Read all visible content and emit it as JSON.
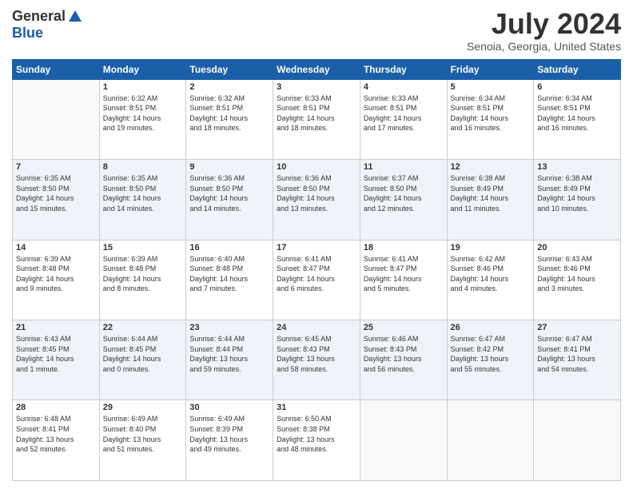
{
  "logo": {
    "general": "General",
    "blue": "Blue"
  },
  "title": "July 2024",
  "location": "Senoia, Georgia, United States",
  "days_header": [
    "Sunday",
    "Monday",
    "Tuesday",
    "Wednesday",
    "Thursday",
    "Friday",
    "Saturday"
  ],
  "weeks": [
    {
      "days": [
        {
          "num": "",
          "info": ""
        },
        {
          "num": "1",
          "info": "Sunrise: 6:32 AM\nSunset: 8:51 PM\nDaylight: 14 hours\nand 19 minutes."
        },
        {
          "num": "2",
          "info": "Sunrise: 6:32 AM\nSunset: 8:51 PM\nDaylight: 14 hours\nand 18 minutes."
        },
        {
          "num": "3",
          "info": "Sunrise: 6:33 AM\nSunset: 8:51 PM\nDaylight: 14 hours\nand 18 minutes."
        },
        {
          "num": "4",
          "info": "Sunrise: 6:33 AM\nSunset: 8:51 PM\nDaylight: 14 hours\nand 17 minutes."
        },
        {
          "num": "5",
          "info": "Sunrise: 6:34 AM\nSunset: 8:51 PM\nDaylight: 14 hours\nand 16 minutes."
        },
        {
          "num": "6",
          "info": "Sunrise: 6:34 AM\nSunset: 8:51 PM\nDaylight: 14 hours\nand 16 minutes."
        }
      ]
    },
    {
      "days": [
        {
          "num": "7",
          "info": "Sunrise: 6:35 AM\nSunset: 8:50 PM\nDaylight: 14 hours\nand 15 minutes."
        },
        {
          "num": "8",
          "info": "Sunrise: 6:35 AM\nSunset: 8:50 PM\nDaylight: 14 hours\nand 14 minutes."
        },
        {
          "num": "9",
          "info": "Sunrise: 6:36 AM\nSunset: 8:50 PM\nDaylight: 14 hours\nand 14 minutes."
        },
        {
          "num": "10",
          "info": "Sunrise: 6:36 AM\nSunset: 8:50 PM\nDaylight: 14 hours\nand 13 minutes."
        },
        {
          "num": "11",
          "info": "Sunrise: 6:37 AM\nSunset: 8:50 PM\nDaylight: 14 hours\nand 12 minutes."
        },
        {
          "num": "12",
          "info": "Sunrise: 6:38 AM\nSunset: 8:49 PM\nDaylight: 14 hours\nand 11 minutes."
        },
        {
          "num": "13",
          "info": "Sunrise: 6:38 AM\nSunset: 8:49 PM\nDaylight: 14 hours\nand 10 minutes."
        }
      ]
    },
    {
      "days": [
        {
          "num": "14",
          "info": "Sunrise: 6:39 AM\nSunset: 8:48 PM\nDaylight: 14 hours\nand 9 minutes."
        },
        {
          "num": "15",
          "info": "Sunrise: 6:39 AM\nSunset: 8:48 PM\nDaylight: 14 hours\nand 8 minutes."
        },
        {
          "num": "16",
          "info": "Sunrise: 6:40 AM\nSunset: 8:48 PM\nDaylight: 14 hours\nand 7 minutes."
        },
        {
          "num": "17",
          "info": "Sunrise: 6:41 AM\nSunset: 8:47 PM\nDaylight: 14 hours\nand 6 minutes."
        },
        {
          "num": "18",
          "info": "Sunrise: 6:41 AM\nSunset: 8:47 PM\nDaylight: 14 hours\nand 5 minutes."
        },
        {
          "num": "19",
          "info": "Sunrise: 6:42 AM\nSunset: 8:46 PM\nDaylight: 14 hours\nand 4 minutes."
        },
        {
          "num": "20",
          "info": "Sunrise: 6:43 AM\nSunset: 8:46 PM\nDaylight: 14 hours\nand 3 minutes."
        }
      ]
    },
    {
      "days": [
        {
          "num": "21",
          "info": "Sunrise: 6:43 AM\nSunset: 8:45 PM\nDaylight: 14 hours\nand 1 minute."
        },
        {
          "num": "22",
          "info": "Sunrise: 6:44 AM\nSunset: 8:45 PM\nDaylight: 14 hours\nand 0 minutes."
        },
        {
          "num": "23",
          "info": "Sunrise: 6:44 AM\nSunset: 8:44 PM\nDaylight: 13 hours\nand 59 minutes."
        },
        {
          "num": "24",
          "info": "Sunrise: 6:45 AM\nSunset: 8:43 PM\nDaylight: 13 hours\nand 58 minutes."
        },
        {
          "num": "25",
          "info": "Sunrise: 6:46 AM\nSunset: 8:43 PM\nDaylight: 13 hours\nand 56 minutes."
        },
        {
          "num": "26",
          "info": "Sunrise: 6:47 AM\nSunset: 8:42 PM\nDaylight: 13 hours\nand 55 minutes."
        },
        {
          "num": "27",
          "info": "Sunrise: 6:47 AM\nSunset: 8:41 PM\nDaylight: 13 hours\nand 54 minutes."
        }
      ]
    },
    {
      "days": [
        {
          "num": "28",
          "info": "Sunrise: 6:48 AM\nSunset: 8:41 PM\nDaylight: 13 hours\nand 52 minutes."
        },
        {
          "num": "29",
          "info": "Sunrise: 6:49 AM\nSunset: 8:40 PM\nDaylight: 13 hours\nand 51 minutes."
        },
        {
          "num": "30",
          "info": "Sunrise: 6:49 AM\nSunset: 8:39 PM\nDaylight: 13 hours\nand 49 minutes."
        },
        {
          "num": "31",
          "info": "Sunrise: 6:50 AM\nSunset: 8:38 PM\nDaylight: 13 hours\nand 48 minutes."
        },
        {
          "num": "",
          "info": ""
        },
        {
          "num": "",
          "info": ""
        },
        {
          "num": "",
          "info": ""
        }
      ]
    }
  ]
}
